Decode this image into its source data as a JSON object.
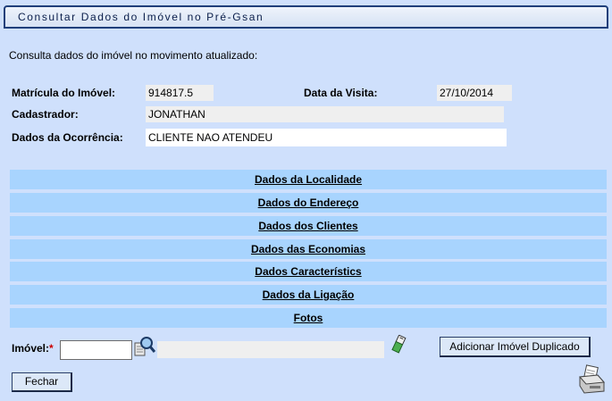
{
  "title": "Consultar Dados do Imóvel no Pré-Gsan",
  "intro": "Consulta dados do imóvel no movimento atualizado:",
  "matricula": {
    "label": "Matrícula do Imóvel:",
    "value": "914817.5"
  },
  "data_visita": {
    "label": "Data da Visita:",
    "value": "27/10/2014"
  },
  "cadastrador": {
    "label": "Cadastrador:",
    "value": "JONATHAN"
  },
  "ocorrencia": {
    "label": "Dados da Ocorrência:",
    "value": "CLIENTE NAO ATENDEU"
  },
  "sections": [
    {
      "label": "Dados da Localidade"
    },
    {
      "label": "Dados do Endereço"
    },
    {
      "label": "Dados dos Clientes"
    },
    {
      "label": "Dados das Economias"
    },
    {
      "label": "Dados Característics"
    },
    {
      "label": "Dados da Ligação"
    },
    {
      "label": "Fotos"
    }
  ],
  "imovel": {
    "label": "Imóvel:",
    "required_mark": "*",
    "value": "",
    "description": ""
  },
  "buttons": {
    "adicionar": "Adicionar Imóvel Duplicado",
    "fechar": "Fechar"
  },
  "icons": [
    "search-icon",
    "eraser-icon",
    "printer-icon"
  ]
}
